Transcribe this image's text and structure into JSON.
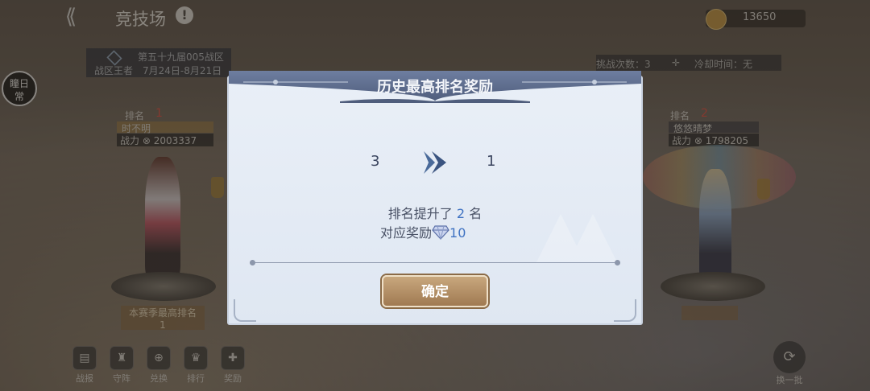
{
  "header": {
    "title": "竞技场",
    "coins": "13650"
  },
  "sidebar": {
    "daily_label_1": "瞳日",
    "daily_label_2": "常"
  },
  "season": {
    "name": "第五十九届005战区",
    "subtitle": "战区王者",
    "dates": "7月24日-8月21日"
  },
  "challenge": {
    "count_label": "挑战次数：3",
    "cooldown_label": "冷却时间：无"
  },
  "left_player": {
    "rank_label": "排名",
    "rank": "1",
    "name": "时不明",
    "power_label": "战力",
    "power": "2003337",
    "best_rank_label": "本赛季最高排名",
    "best_rank": "1"
  },
  "right_player": {
    "rank_label": "排名",
    "rank": "2",
    "name": "悠悠晴梦",
    "power_label": "战力",
    "power": "1798205"
  },
  "bottom_nav": [
    {
      "label": "战报"
    },
    {
      "label": "守阵"
    },
    {
      "label": "兑换"
    },
    {
      "label": "排行"
    },
    {
      "label": "奖励"
    }
  ],
  "swap_label": "换一批",
  "modal": {
    "title": "历史最高排名奖励",
    "old_rank": "3",
    "new_rank": "1",
    "msg_prefix": "排名提升了",
    "msg_value": "2",
    "msg_suffix": "名",
    "reward_prefix": "对应奖励",
    "reward_value": "10",
    "confirm_label": "确定"
  },
  "colors": {
    "accent": "#3f72c2",
    "button": "#b08a62",
    "header": "#5b6a8a"
  }
}
